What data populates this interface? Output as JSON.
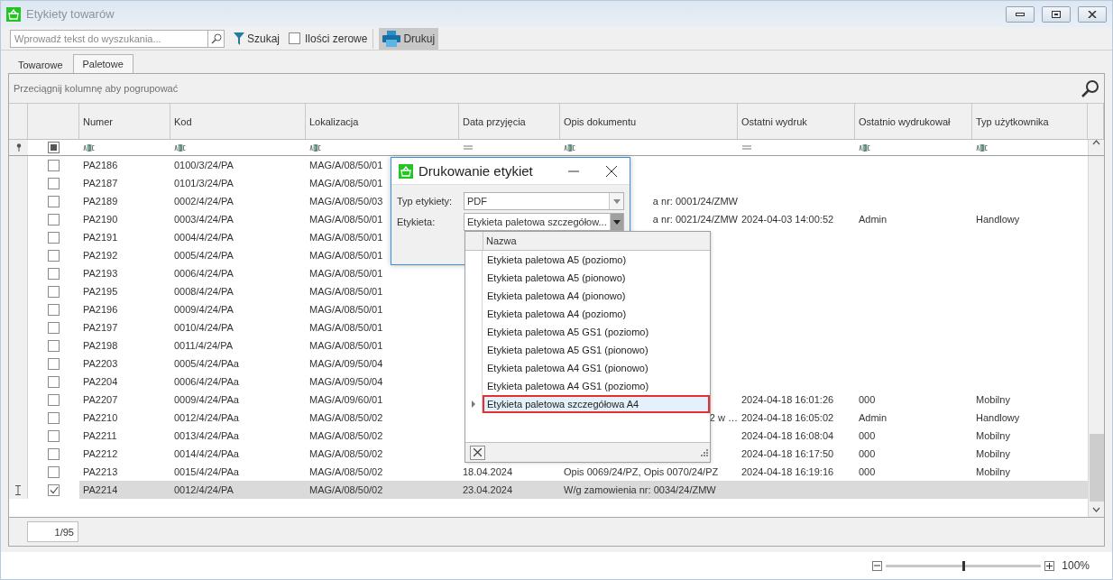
{
  "window": {
    "title": "Etykiety towarów"
  },
  "toolbar": {
    "search_placeholder": "Wprowadź tekst do wyszukania...",
    "filter_label": "Szukaj",
    "zero_checkbox": {
      "label": "Ilości zerowe",
      "checked": false
    },
    "print_label": "Drukuj"
  },
  "tabs": [
    {
      "label": "Towarowe",
      "selected": false
    },
    {
      "label": "Paletowe",
      "selected": true
    }
  ],
  "group_hint": "Przeciągnij kolumnę aby pogrupować",
  "select_all_partial": true,
  "columns": [
    {
      "label": "Numer",
      "kind": "text"
    },
    {
      "label": "Kod",
      "kind": "text"
    },
    {
      "label": "Lokalizacja",
      "kind": "text"
    },
    {
      "label": "Data przyjęcia",
      "kind": "date"
    },
    {
      "label": "Opis dokumentu",
      "kind": "text"
    },
    {
      "label": "Ostatni wydruk",
      "kind": "date"
    },
    {
      "label": "Ostatnio wydrukował",
      "kind": "text"
    },
    {
      "label": "Typ użytkownika",
      "kind": "text"
    }
  ],
  "rows": [
    {
      "cells": [
        "PA2186",
        "0100/3/24/PA",
        "MAG/A/08/50/01",
        null,
        null,
        null,
        null,
        null
      ],
      "checked": false,
      "selected": false
    },
    {
      "cells": [
        "PA2187",
        "0101/3/24/PA",
        "MAG/A/08/50/01",
        null,
        null,
        null,
        null,
        null
      ],
      "checked": false,
      "selected": false
    },
    {
      "cells": [
        "PA2189",
        "0002/4/24/PA",
        "MAG/A/08/50/03",
        null,
        "a nr: 0001/24/ZMW",
        null,
        null,
        null
      ],
      "checked": false,
      "selected": false,
      "opis_partial": true
    },
    {
      "cells": [
        "PA2190",
        "0003/4/24/PA",
        "MAG/A/08/50/01",
        null,
        "a nr: 0021/24/ZMW",
        "2024-04-03 14:00:52",
        "Admin",
        "Handlowy"
      ],
      "checked": false,
      "selected": false,
      "opis_partial": true
    },
    {
      "cells": [
        "PA2191",
        "0004/4/24/PA",
        "MAG/A/08/50/01",
        null,
        null,
        null,
        null,
        null
      ],
      "checked": false,
      "selected": false
    },
    {
      "cells": [
        "PA2192",
        "0005/4/24/PA",
        "MAG/A/08/50/01",
        null,
        null,
        null,
        null,
        null
      ],
      "checked": false,
      "selected": false
    },
    {
      "cells": [
        "PA2193",
        "0006/4/24/PA",
        "MAG/A/08/50/01",
        null,
        null,
        null,
        null,
        null
      ],
      "checked": false,
      "selected": false
    },
    {
      "cells": [
        "PA2195",
        "0008/4/24/PA",
        "MAG/A/08/50/01",
        null,
        null,
        null,
        null,
        null
      ],
      "checked": false,
      "selected": false
    },
    {
      "cells": [
        "PA2196",
        "0009/4/24/PA",
        "MAG/A/08/50/01",
        null,
        null,
        null,
        null,
        null
      ],
      "checked": false,
      "selected": false
    },
    {
      "cells": [
        "PA2197",
        "0010/4/24/PA",
        "MAG/A/08/50/01",
        null,
        null,
        null,
        null,
        null
      ],
      "checked": false,
      "selected": false
    },
    {
      "cells": [
        "PA2198",
        "0011/4/24/PA",
        "MAG/A/08/50/01",
        null,
        null,
        null,
        null,
        null
      ],
      "checked": false,
      "selected": false
    },
    {
      "cells": [
        "PA2203",
        "0005/4/24/PAa",
        "MAG/A/09/50/04",
        null,
        null,
        null,
        null,
        null
      ],
      "checked": false,
      "selected": false
    },
    {
      "cells": [
        "PA2204",
        "0006/4/24/PAa",
        "MAG/A/09/50/04",
        null,
        null,
        null,
        null,
        null
      ],
      "checked": false,
      "selected": false
    },
    {
      "cells": [
        "PA2207",
        "0009/4/24/PAa",
        "MAG/A/09/60/01",
        null,
        null,
        "2024-04-18 16:01:26",
        "000",
        "Mobilny"
      ],
      "checked": false,
      "selected": false
    },
    {
      "cells": [
        "PA2210",
        "0012/4/24/PAa",
        "MAG/A/08/50/02",
        null,
        "2 w …",
        "2024-04-18 16:05:02",
        "Admin",
        "Handlowy"
      ],
      "checked": false,
      "selected": false,
      "opis_partial": true
    },
    {
      "cells": [
        "PA2211",
        "0013/4/24/PAa",
        "MAG/A/08/50/02",
        null,
        null,
        "2024-04-18 16:08:04",
        "000",
        "Mobilny"
      ],
      "checked": false,
      "selected": false
    },
    {
      "cells": [
        "PA2212",
        "0014/4/24/PAa",
        "MAG/A/08/50/02",
        null,
        null,
        "2024-04-18 16:17:50",
        "000",
        "Mobilny"
      ],
      "checked": false,
      "selected": false
    },
    {
      "cells": [
        "PA2213",
        "0015/4/24/PAa",
        "MAG/A/08/50/02",
        "18.04.2024",
        "Opis 0069/24/PZ, Opis 0070/24/PZ",
        "2024-04-18 16:19:16",
        "000",
        "Mobilny"
      ],
      "checked": false,
      "selected": false
    },
    {
      "cells": [
        "PA2214",
        "0012/4/24/PA",
        "MAG/A/08/50/02",
        "23.04.2024",
        "W/g zamowienia nr: 0034/24/ZMW",
        null,
        null,
        null
      ],
      "checked": true,
      "selected": true,
      "current": true
    }
  ],
  "pager": "1/95",
  "zoom": {
    "level": 0.5,
    "reading": "100%"
  },
  "dialog": {
    "title": "Drukowanie etykiet",
    "fields": [
      {
        "label": "Typ etykiety:",
        "value": "PDF",
        "open": false
      },
      {
        "label": "Etykieta:",
        "value": "Etykieta paletowa szczegółow...",
        "open": true
      }
    ],
    "list": {
      "header": "Nazwa",
      "items": [
        {
          "label": "Etykieta paletowa A5 (poziomo)",
          "selected": false
        },
        {
          "label": "Etykieta paletowa A5 (pionowo)",
          "selected": false
        },
        {
          "label": "Etykieta paletowa A4 (pionowo)",
          "selected": false
        },
        {
          "label": "Etykieta paletowa A4 (poziomo)",
          "selected": false
        },
        {
          "label": "Etykieta paletowa A5 GS1 (poziomo)",
          "selected": false
        },
        {
          "label": "Etykieta paletowa A5 GS1 (pionowo)",
          "selected": false
        },
        {
          "label": "Etykieta paletowa A4 GS1 (pionowo)",
          "selected": false
        },
        {
          "label": "Etykieta paletowa A4 GS1 (poziomo)",
          "selected": false
        },
        {
          "label": "Etykieta paletowa szczegółowa A4",
          "selected": true
        }
      ]
    }
  }
}
